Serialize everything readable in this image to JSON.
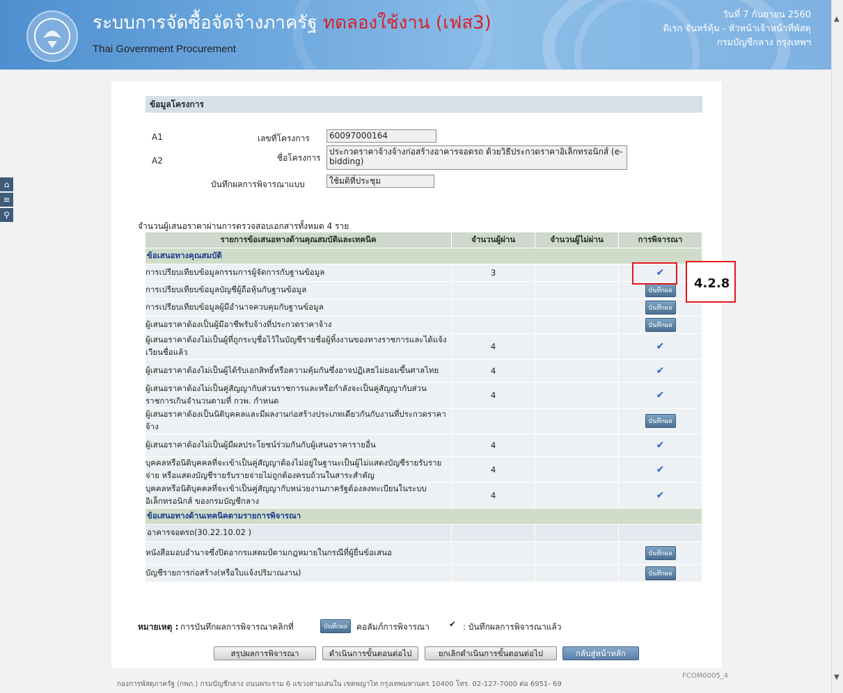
{
  "header": {
    "title_main": "ระบบการจัดซื้อจัดจ้างภาครัฐ",
    "title_test": "ทดลองใช้งาน (เฟส3)",
    "subtitle": "Thai Government Procurement",
    "date": "วันที่ 7 กันยายน 2560",
    "user": "ดิเรก จันทร์คุ้ม - หัวหน้าเจ้าหน้าที่พัสดุ",
    "org": "กรมบัญชีกลาง กรุงเทพฯ"
  },
  "section_title": "ข้อมูลโครงการ",
  "fields": {
    "a1_code": "A1",
    "a1_label": "เลขที่โครงการ",
    "a1_value": "60097000164",
    "a2_code": "A2",
    "a2_label": "ชื่อโครงการ",
    "a2_value": "ประกวดราคาจ้างจ้างก่อสร้างอาคารจอดรถ ด้วยวิธีประกวดราคาอิเล็กทรอนิกส์ (e-bidding)",
    "mode_label": "บันทึกผลการพิจารณาแบบ",
    "mode_value": "ใช้มติที่ประชุม"
  },
  "summary": "จำนวนผู้เสนอราคาผ่านการตรวจสอบเอกสารทั้งหมด  4  ราย",
  "table": {
    "headers": [
      "รายการข้อเสนอทางด้านคุณสมบัติและเทคนิค",
      "จำนวนผู้ผ่าน",
      "จำนวนผู้ไม่ผ่าน",
      "การพิจารณา"
    ],
    "section1": "ข้อเสนอทางคุณสมบัติ",
    "rows1": [
      {
        "label": "การเปรียบเทียบข้อมูลกรรมการผู้จัดการกับฐานข้อมูล",
        "pass": "3",
        "fail": "",
        "action": "check"
      },
      {
        "label": "การเปรียบเทียบข้อมูลบัญชีผู้ถือหุ้นกับฐานข้อมูล",
        "pass": "",
        "fail": "",
        "action": "button"
      },
      {
        "label": "การเปรียบเทียบข้อมูลผู้มีอำนาจควบคุมกับฐานข้อมูล",
        "pass": "",
        "fail": "",
        "action": "button"
      },
      {
        "label": "ผู้เสนอราคาต้องเป็นผู้มีอาชีพรับจ้างที่ประกวดราคาจ้าง",
        "pass": "",
        "fail": "",
        "action": "button"
      },
      {
        "label": "ผู้เสนอราคาต้องไม่เป็นผู้ที่ถูกระบุชื่อไว้ในบัญชีรายชื่อผู้ทิ้งงานของทางราชการและได้แจ้งเวียนชื่อแล้ว",
        "pass": "4",
        "fail": "",
        "action": "check"
      },
      {
        "label": "ผู้เสนอราคาต้องไม่เป็นผู้ได้รับเอกสิทธิ์หรือความคุ้มกันซึ่งอาจปฏิเสธไม่ยอมขึ้นศาลไทย",
        "pass": "4",
        "fail": "",
        "action": "check"
      },
      {
        "label": "ผู้เสนอราคาต้องไม่เป็นคู่สัญญากับส่วนราชการและหรือกำลังจะเป็นคู่สัญญากับส่วนราชการเกินจำนวนตามที่ กวพ. กำหนด",
        "pass": "4",
        "fail": "",
        "action": "check"
      },
      {
        "label": "ผู้เสนอราคาต้องเป็นนิติบุคคลและมีผลงานก่อสร้างประเภทเดียวกันกับงานที่ประกวดราคาจ้าง",
        "pass": "",
        "fail": "",
        "action": "button"
      },
      {
        "label": "ผู้เสนอราคาต้องไม่เป็นผู้มีผลประโยชน์ร่วมกันกับผู้เสนอราคารายอื่น",
        "pass": "4",
        "fail": "",
        "action": "check"
      },
      {
        "label": "บุคคลหรือนิติบุคคลที่จะเข้าเป็นคู่สัญญาต้องไม่อยู่ในฐานะเป็นผู้ไม่แสดงบัญชีรายรับรายจ่าย หรือแสดงบัญชีรายรับรายจ่ายไม่ถูกต้องครบถ้วนในสาระสำคัญ",
        "pass": "4",
        "fail": "",
        "action": "check"
      },
      {
        "label": "บุคคลหรือนิติบุคคลที่จะเข้าเป็นคู่สัญญากับหน่วยงานภาครัฐต้องลงทะเบียนในระบบอิเล็กทรอนิกส์ ของกรมบัญชีกลาง",
        "pass": "4",
        "fail": "",
        "action": "check"
      }
    ],
    "section2": "ข้อเสนอทางด้านเทคนิคตามรายการพิจารณา",
    "subsection2": "อาคารจอดรถ(30.22.10.02 )",
    "rows2": [
      {
        "label": "หนังสือมอบอำนาจซึ่งปิดอากรแสตมป์ตามกฎหมายในกรณีที่ผู้ยื่นข้อเสนอ",
        "pass": "",
        "fail": "",
        "action": "button"
      },
      {
        "label": "บัญชีรายการก่อสร้าง(หรือใบแจ้งปริมาณงาน)",
        "pass": "",
        "fail": "",
        "action": "button"
      }
    ],
    "button_label": "บันทึกผล",
    "check_glyph": "✔"
  },
  "callout": "4.2.8",
  "note": {
    "prefix": "หมายเหตุ :",
    "text1": "การบันทึกผลการพิจารณาคลิกที่",
    "text2": "คอลัมภ์การพิจารณา",
    "text3": ": บันทึกผลการพิจารณาแล้ว"
  },
  "actions": {
    "summary": "สรุปผลการพิจารณา",
    "next": "ดำเนินการขั้นตอนต่อไป",
    "cancel": "ยกเลิกดำเนินการขั้นตอนต่อไป",
    "home": "กลับสู่หน้าหลัก"
  },
  "footer": "กองการพัสดุภาครัฐ (กพภ.) กรมบัญชีกลาง ถนนพระราม 6 แขวงสามเสนใน เขตพญาไท กรุงเทพมหานคร 10400 โทร. 02-127-7000 ต่อ 6951- 69",
  "page_code": "FCOM0005_4"
}
